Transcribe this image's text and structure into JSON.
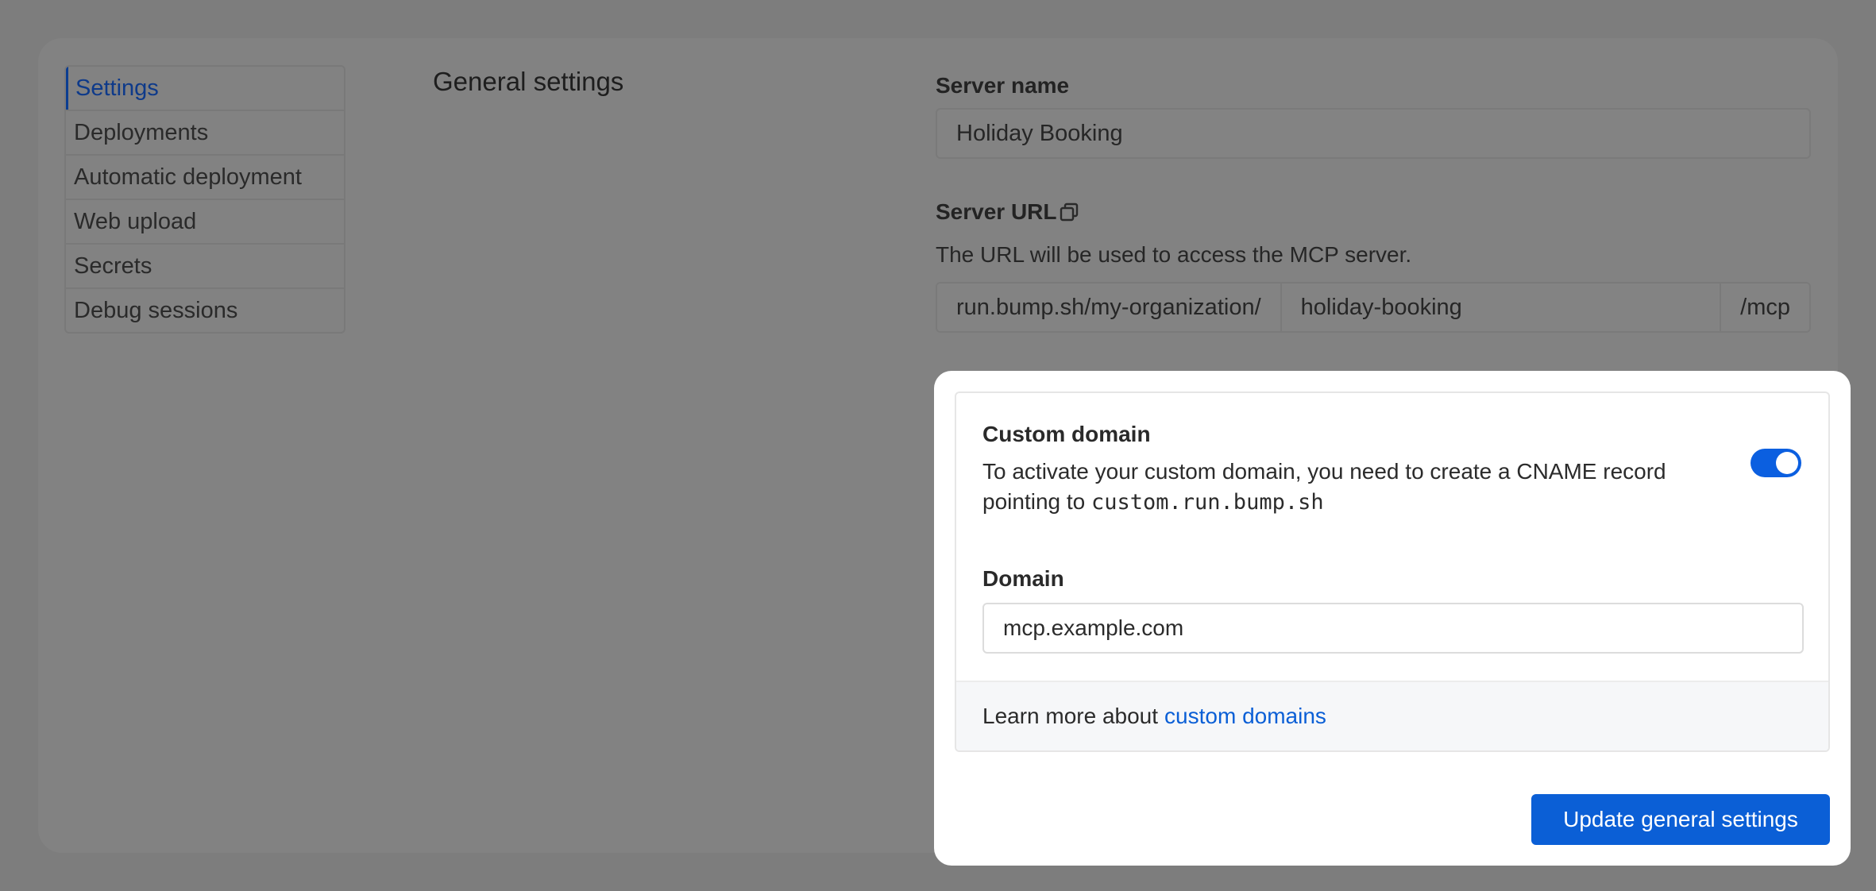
{
  "sidebar": {
    "items": [
      {
        "label": "Settings",
        "active": true
      },
      {
        "label": "Deployments"
      },
      {
        "label": "Automatic deployment"
      },
      {
        "label": "Web upload"
      },
      {
        "label": "Secrets"
      },
      {
        "label": "Debug sessions"
      }
    ]
  },
  "general": {
    "title": "General settings",
    "server_name_label": "Server name",
    "server_name_value": "Holiday Booking",
    "server_url_label": "Server URL",
    "server_url_help": "The URL will be used to access the MCP server.",
    "url_prefix": "run.bump.sh/my-organization/",
    "url_slug": "holiday-booking",
    "url_suffix": "/mcp",
    "copy_icon": "copy-icon"
  },
  "custom_domain": {
    "title": "Custom domain",
    "description_prefix": "To activate your custom domain, you need to create a CNAME record pointing to",
    "cname_target": "custom.run.bump.sh",
    "toggle_on": true,
    "domain_label": "Domain",
    "domain_value": "mcp.example.com",
    "learn_more_text": "Learn more about",
    "learn_more_link": "custom domains"
  },
  "actions": {
    "update_button": "Update general settings"
  },
  "colors": {
    "accent": "#0b5fd6",
    "overlay": "#7d7d7d"
  }
}
